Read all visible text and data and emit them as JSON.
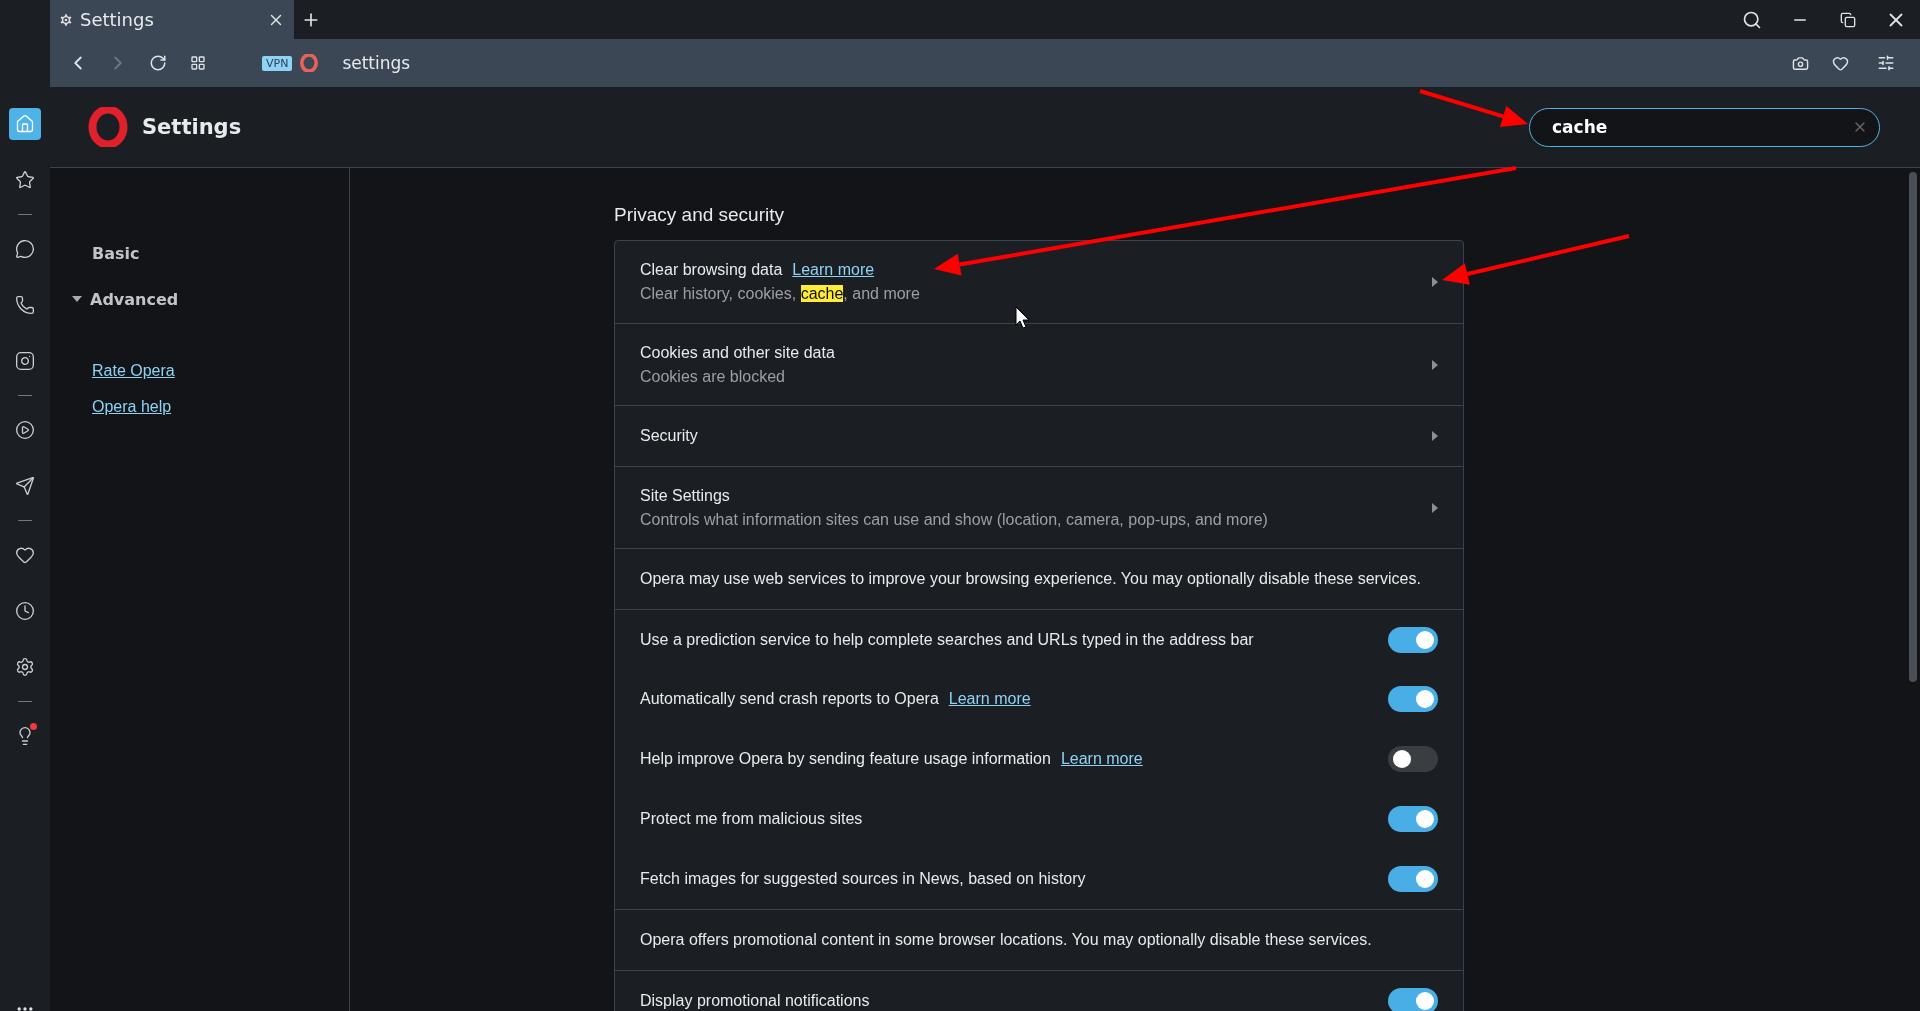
{
  "tab": {
    "title": "Settings"
  },
  "address_bar": {
    "badge": "VPN",
    "url": "settings"
  },
  "sidebar": {
    "items": [
      {
        "selected": true
      },
      {
        "selected": false
      },
      {
        "selected": false
      },
      {
        "selected": false
      },
      {
        "selected": false
      },
      {
        "selected": false
      },
      {
        "selected": false
      },
      {
        "selected": false
      },
      {
        "selected": false
      },
      {
        "selected": false
      },
      {
        "selected": false
      }
    ]
  },
  "header": {
    "title": "Settings"
  },
  "search": {
    "value": "cache"
  },
  "nav": {
    "items": [
      {
        "label": "Basic",
        "kind": "section"
      },
      {
        "label": "Advanced",
        "kind": "expander",
        "expanded": true
      }
    ],
    "links": [
      "Rate Opera",
      "Opera help"
    ]
  },
  "section": {
    "title": "Privacy and security",
    "rows": [
      {
        "kind": "link",
        "title": "Clear browsing data",
        "link": "Learn more",
        "subtitle": {
          "before": "Clear history, cookies, ",
          "match": "cache",
          "after": ", and more"
        }
      },
      {
        "kind": "link",
        "title": "Cookies and other site data",
        "subtitle": {
          "before": "Cookies are blocked"
        }
      },
      {
        "kind": "link",
        "title": "Security"
      },
      {
        "kind": "link",
        "title": "Site Settings",
        "subtitle": {
          "before": "Controls what information sites can use and show (location, camera, pop-ups, and more)"
        }
      },
      {
        "kind": "info",
        "text": "Opera may use web services to improve your browsing experience. You may optionally disable these services."
      },
      {
        "kind": "toggle",
        "label": "Use a prediction service to help complete searches and URLs typed in the address bar",
        "on": true
      },
      {
        "kind": "toggle",
        "label": "Automatically send crash reports to Opera",
        "link": "Learn more",
        "on": true
      },
      {
        "kind": "toggle",
        "label": "Help improve Opera by sending feature usage information",
        "link": "Learn more",
        "on": false
      },
      {
        "kind": "toggle",
        "label": "Protect me from malicious sites",
        "on": true
      },
      {
        "kind": "toggle",
        "label": "Fetch images for suggested sources in News, based on history",
        "on": true
      },
      {
        "kind": "info",
        "text": "Opera offers promotional content in some browser locations. You may optionally disable these services."
      },
      {
        "kind": "toggle",
        "label": "Display promotional notifications",
        "on": true
      }
    ]
  }
}
